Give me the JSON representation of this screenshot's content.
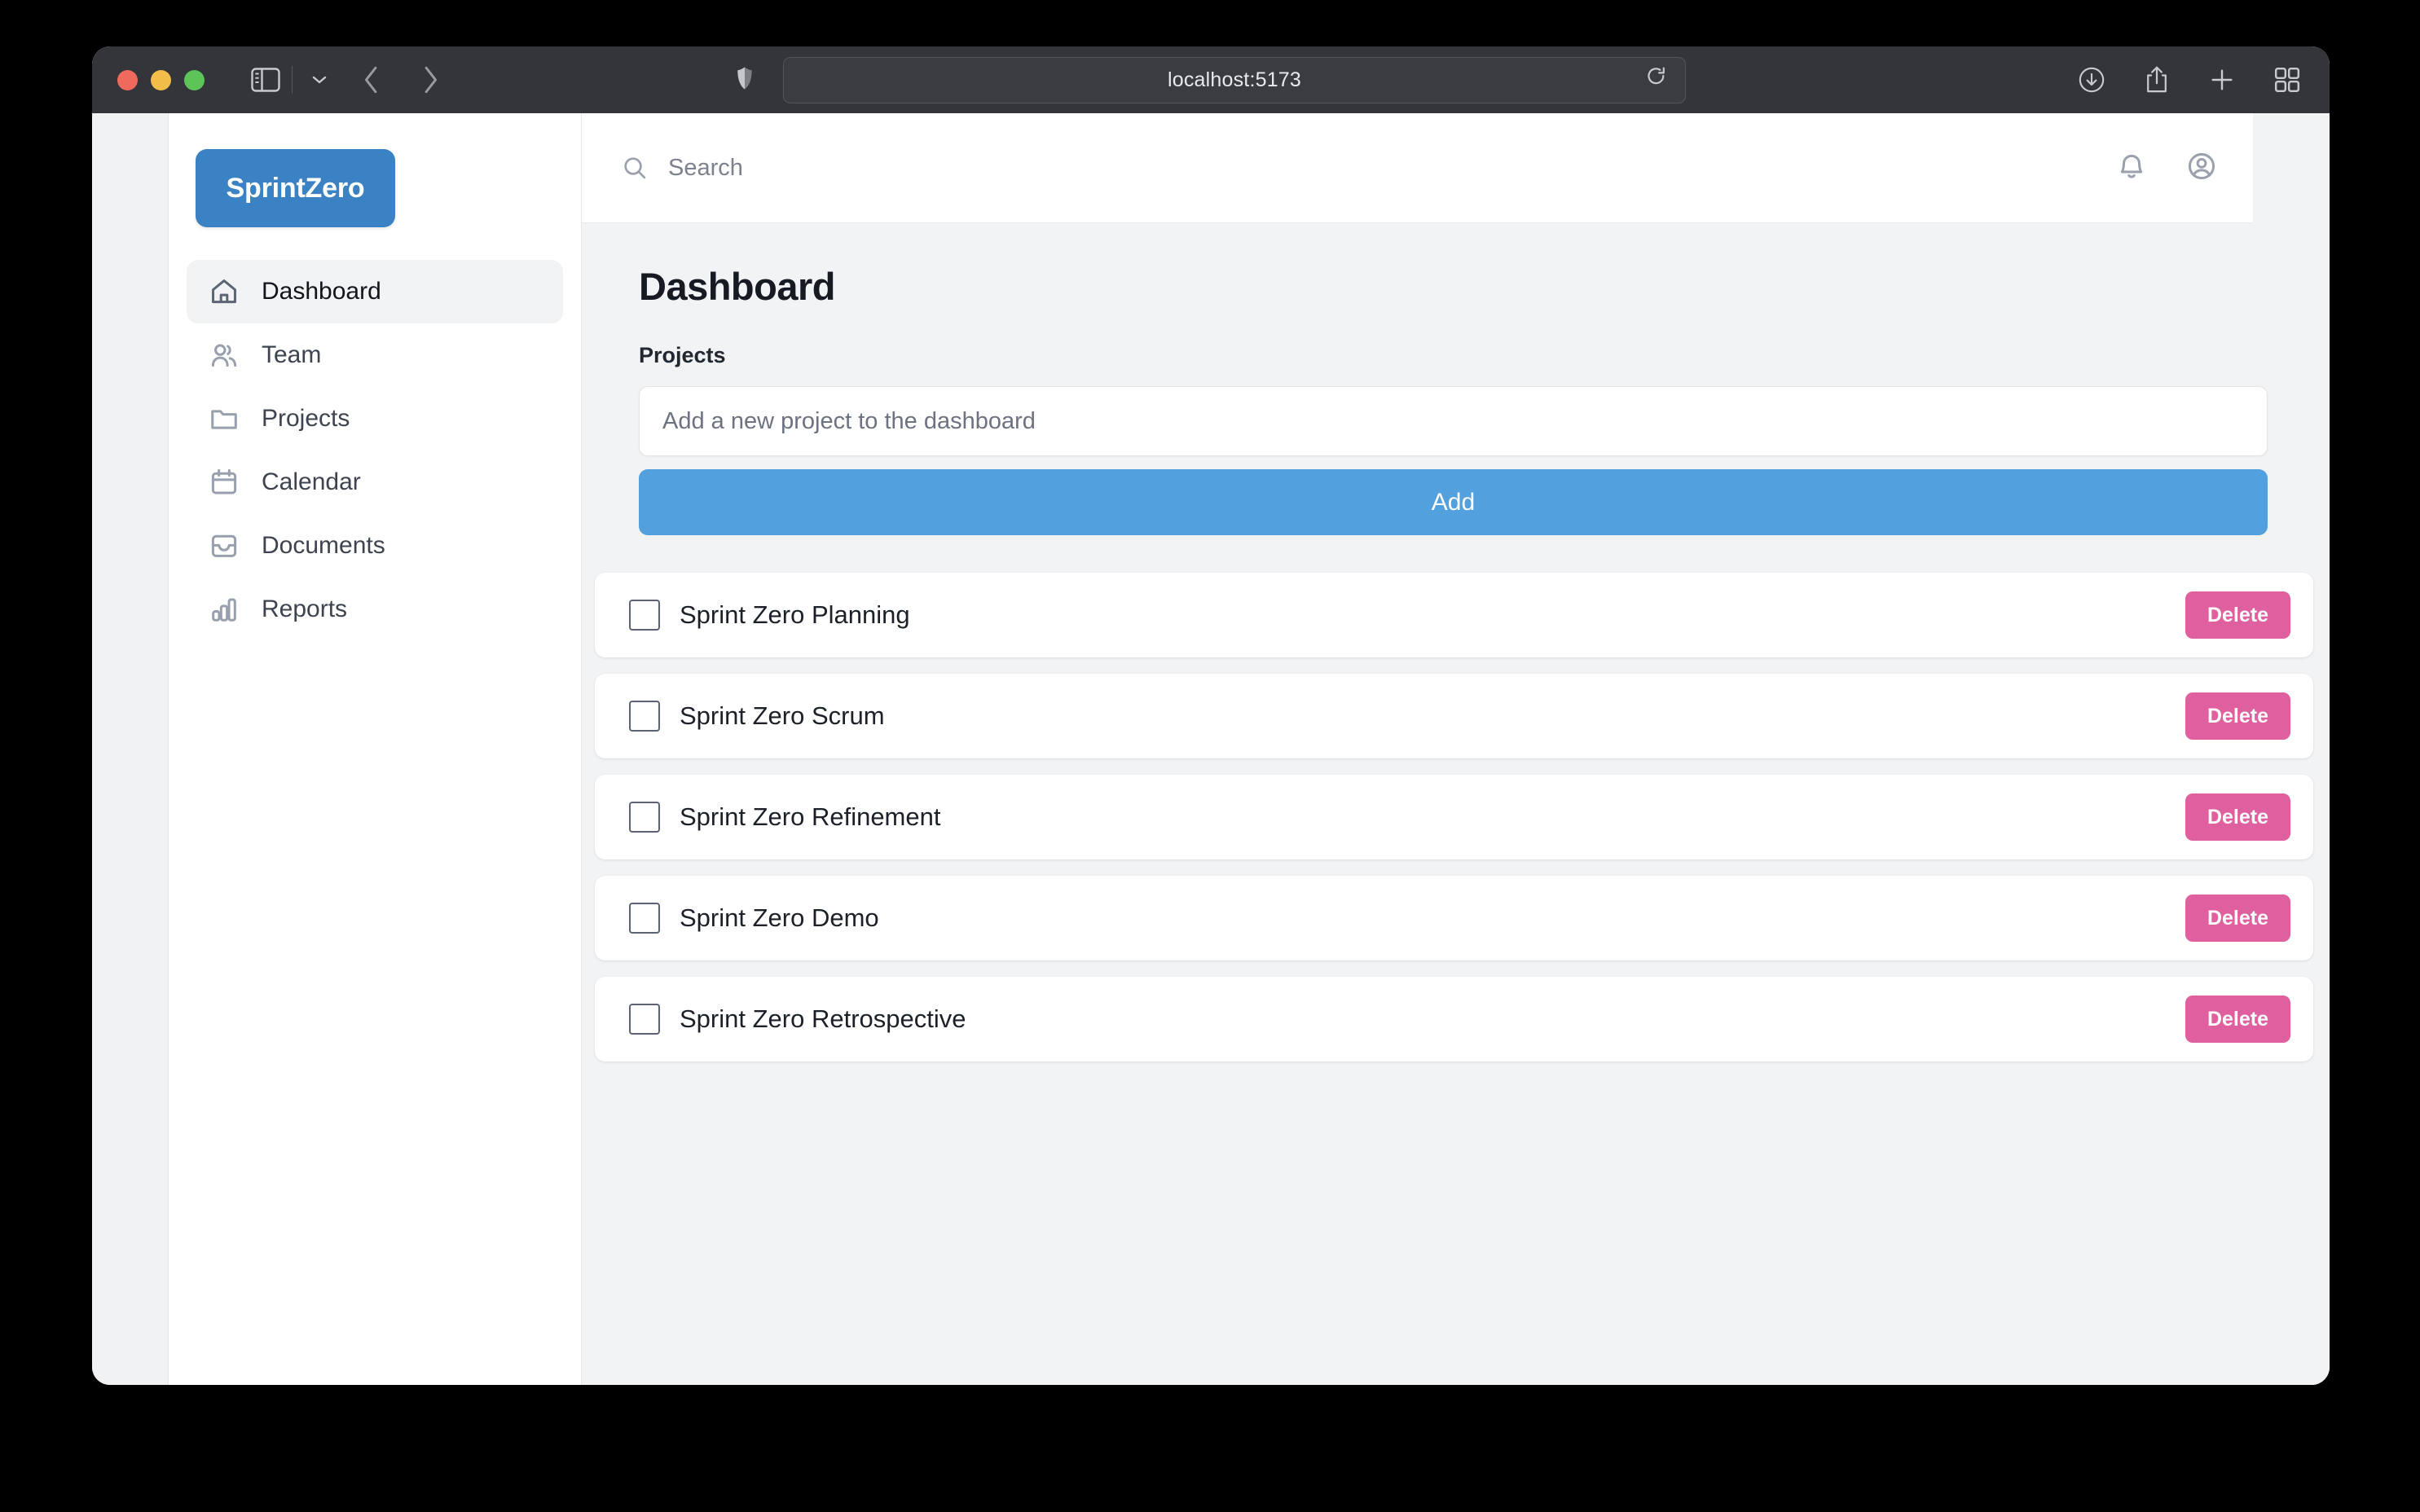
{
  "browser": {
    "url": "localhost:5173",
    "window_buttons": [
      "close",
      "minimize",
      "zoom"
    ],
    "toolbar_icons": [
      "sidebar-toggle-icon",
      "chevron-down-icon",
      "back-icon",
      "forward-icon",
      "shield-icon",
      "reload-icon",
      "downloads-icon",
      "share-icon",
      "new-tab-icon",
      "tab-overview-icon"
    ]
  },
  "app": {
    "logo": "SprintZero",
    "sidebar": {
      "items": [
        {
          "label": "Dashboard",
          "icon": "home-icon",
          "active": true
        },
        {
          "label": "Team",
          "icon": "users-icon",
          "active": false
        },
        {
          "label": "Projects",
          "icon": "folder-icon",
          "active": false
        },
        {
          "label": "Calendar",
          "icon": "calendar-icon",
          "active": false
        },
        {
          "label": "Documents",
          "icon": "inbox-icon",
          "active": false
        },
        {
          "label": "Reports",
          "icon": "bar-chart-icon",
          "active": false
        }
      ]
    },
    "header": {
      "search_placeholder": "Search",
      "search_value": "",
      "notifications_icon": "bell-icon",
      "account_icon": "user-circle-icon"
    },
    "main": {
      "title": "Dashboard",
      "form": {
        "label": "Projects",
        "input_placeholder": "Add a new project to the dashboard",
        "input_value": "",
        "submit_label": "Add"
      },
      "projects": [
        {
          "name": "Sprint Zero Planning",
          "checked": false,
          "delete_label": "Delete"
        },
        {
          "name": "Sprint Zero Scrum",
          "checked": false,
          "delete_label": "Delete"
        },
        {
          "name": "Sprint Zero Refinement",
          "checked": false,
          "delete_label": "Delete"
        },
        {
          "name": "Sprint Zero Demo",
          "checked": false,
          "delete_label": "Delete"
        },
        {
          "name": "Sprint Zero Retrospective",
          "checked": false,
          "delete_label": "Delete"
        }
      ]
    }
  },
  "colors": {
    "logo_blue": "#3a82c4",
    "add_button_blue": "#52a0de",
    "delete_pink": "#e0609f",
    "page_background": "#f1f3f5",
    "titlebar": "#34353a"
  }
}
